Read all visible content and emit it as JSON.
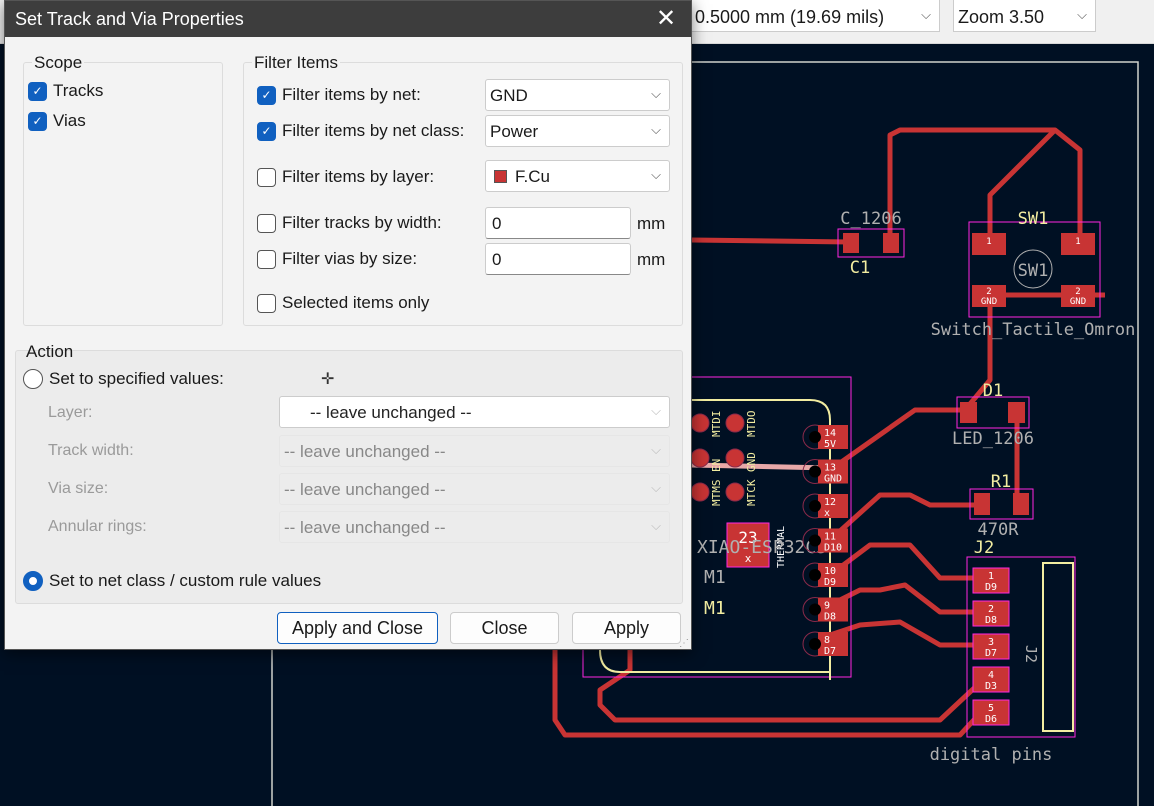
{
  "toolbar": {
    "track_width": "0.5000 mm (19.69 mils)",
    "zoom": "Zoom 3.50"
  },
  "dialog": {
    "title": "Set Track and Via Properties",
    "scope": {
      "title": "Scope",
      "tracks": {
        "label": "Tracks",
        "checked": true
      },
      "vias": {
        "label": "Vias",
        "checked": true
      }
    },
    "filter": {
      "title": "Filter Items",
      "by_net": {
        "label": "Filter items by net:",
        "checked": true,
        "value": "GND"
      },
      "by_net_class": {
        "label": "Filter items by net class:",
        "checked": true,
        "value": "Power"
      },
      "by_layer": {
        "label": "Filter items by layer:",
        "checked": false,
        "value": "F.Cu",
        "swatch": "#c83434"
      },
      "by_width": {
        "label": "Filter tracks by width:",
        "checked": false,
        "value": "0",
        "unit": "mm"
      },
      "by_via_size": {
        "label": "Filter vias by size:",
        "checked": false,
        "value": "0",
        "unit": "mm"
      },
      "selected_only": {
        "label": "Selected items only",
        "checked": false
      }
    },
    "action": {
      "title": "Action",
      "specified": {
        "label": "Set to specified values:",
        "selected": false
      },
      "layer": {
        "label": "Layer:",
        "value": "-- leave unchanged --"
      },
      "track_width": {
        "label": "Track width:",
        "value": "-- leave unchanged --"
      },
      "via_size": {
        "label": "Via size:",
        "value": "-- leave unchanged --"
      },
      "annular": {
        "label": "Annular rings:",
        "value": "-- leave unchanged --"
      },
      "netclass": {
        "label": "Set to net class / custom rule values",
        "selected": true
      }
    },
    "buttons": {
      "apply_close": "Apply and Close",
      "close": "Close",
      "apply": "Apply"
    }
  },
  "pcb": {
    "colors": {
      "background": "#001023",
      "copper": "#c83434",
      "silk": "#f2eda1",
      "courtyard": "#ff26e2",
      "outline": "#d0d2cd",
      "fab": "#b0b0b0"
    },
    "c1_value": "C_1206",
    "c1_ref": "C1",
    "sw1_ref": "SW1",
    "sw1_fab": "SW1",
    "sw1_value": "Switch_Tactile_Omron",
    "sw_pad1": "1",
    "sw_pad2": "2",
    "gnd": "GND",
    "d1_ref": "D1",
    "d1_value": "LED_1206",
    "r1_ref": "R1",
    "r1_value": "470R",
    "j2_ref": "J2",
    "j2_fab": "J2",
    "j2_value": "digital pins",
    "j2_pads": [
      {
        "n": "1",
        "s": "D9"
      },
      {
        "n": "2",
        "s": "D8"
      },
      {
        "n": "3",
        "s": "D7"
      },
      {
        "n": "4",
        "s": "D3"
      },
      {
        "n": "5",
        "s": "D6"
      }
    ],
    "m1_fab": "M1",
    "m1_ref": "M1",
    "m1_value": "XIAO-ESP32C3",
    "m1_pads": [
      {
        "n": "14",
        "s": "5V"
      },
      {
        "n": "13",
        "s": "GND"
      },
      {
        "n": "12",
        "s": "x"
      },
      {
        "n": "11",
        "s": "D10"
      },
      {
        "n": "10",
        "s": "D9"
      },
      {
        "n": "9",
        "s": "D8"
      },
      {
        "n": "8",
        "s": "D7"
      }
    ],
    "thermal_num": "23",
    "thermal_x": "x",
    "thermal": "THERMAL",
    "jtag": [
      "MTDI",
      "MTDO",
      "EN",
      "GND",
      "MTMS",
      "MTCK"
    ]
  }
}
